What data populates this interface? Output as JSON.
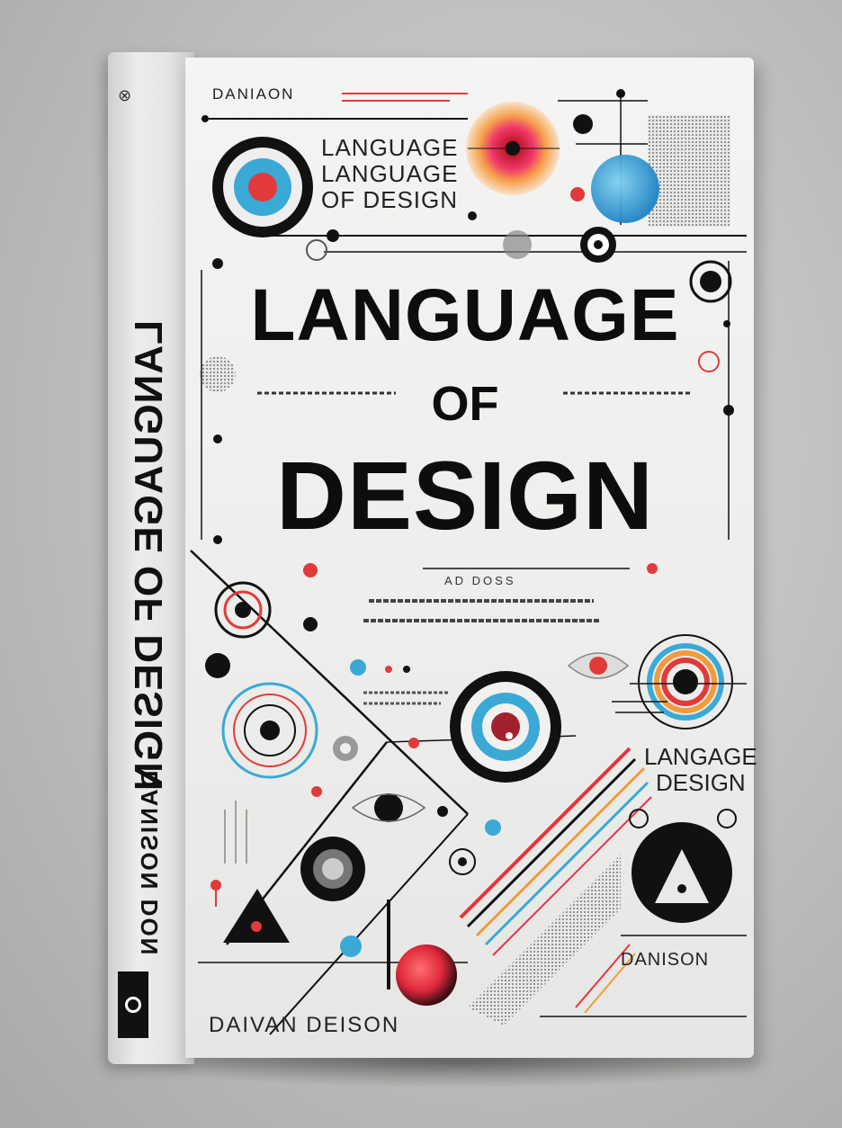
{
  "book": {
    "spine_title": "LANGUAGE OF DESIGN",
    "spine_author": "DANISON DON",
    "top_author": "DANIAON",
    "small_title_line1": "LANGUAGE",
    "small_title_line2": "LANGUAGE",
    "small_title_line3": "OF DESIGN",
    "title_line1": "LANGUAGE",
    "title_line2": "OF",
    "title_line3": "DESIGN",
    "sub_code": "AD DOSS",
    "side_title_line1": "LANGAGE",
    "side_title_line2": "DESIGN",
    "bottom_right_author": "DANISON",
    "bottom_author": "DAIVAN DEISON"
  },
  "colors": {
    "accent_red": "#e8323c",
    "accent_blue": "#3aa9d6",
    "accent_orange": "#f39a3a",
    "ink": "#111111",
    "paper": "#f1f1ef"
  }
}
